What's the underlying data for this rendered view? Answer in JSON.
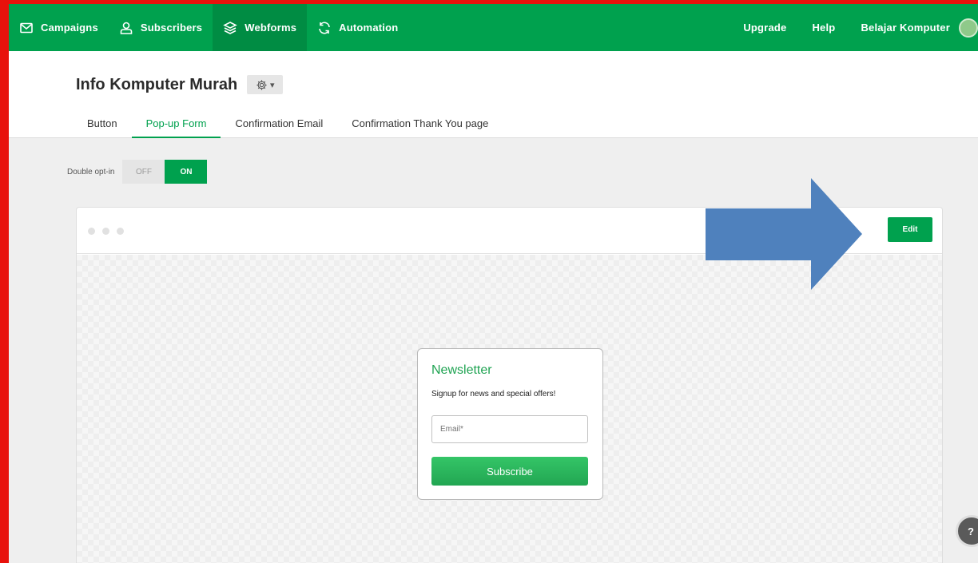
{
  "topnav": {
    "items": [
      {
        "label": "Campaigns",
        "icon": "envelope-icon"
      },
      {
        "label": "Subscribers",
        "icon": "user-icon"
      },
      {
        "label": "Webforms",
        "icon": "layers-icon"
      },
      {
        "label": "Automation",
        "icon": "refresh-icon"
      }
    ],
    "right": {
      "upgrade": "Upgrade",
      "help": "Help",
      "user": "Belajar Komputer"
    },
    "color": "#00a14e"
  },
  "header": {
    "title": "Info Komputer Murah",
    "tabs": [
      {
        "label": "Button"
      },
      {
        "label": "Pop-up Form"
      },
      {
        "label": "Confirmation Email"
      },
      {
        "label": "Confirmation Thank You page"
      }
    ]
  },
  "optin": {
    "label": "Double opt-in",
    "off": "OFF",
    "on": "ON"
  },
  "preview": {
    "edit_label": "Edit",
    "form": {
      "title": "Newsletter",
      "subtitle": "Signup for news and special offers!",
      "email_placeholder": "Email*",
      "subscribe_label": "Subscribe"
    }
  },
  "help_bubble": "?",
  "annotation": {
    "arrow_color": "#4f81bd"
  }
}
